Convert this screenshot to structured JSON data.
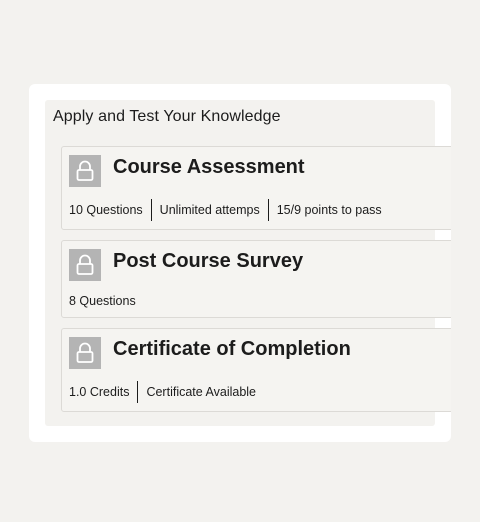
{
  "section": {
    "title": "Apply and Test Your Knowledge"
  },
  "items": [
    {
      "title": "Course Assessment",
      "icon": "lock-icon",
      "meta": [
        "10 Questions",
        "Unlimited attemps",
        "15/9 points to pass"
      ]
    },
    {
      "title": "Post Course Survey",
      "icon": "lock-icon",
      "meta": [
        "8 Questions"
      ]
    },
    {
      "title": "Certificate of Completion",
      "icon": "lock-icon",
      "meta": [
        "1.0 Credits",
        "Certificate Available"
      ]
    }
  ],
  "colors": {
    "page_background": "#f3f2ef",
    "card_background": "#ffffff",
    "lock_tile": "#b4b4b4",
    "text": "#1c1c1c"
  }
}
